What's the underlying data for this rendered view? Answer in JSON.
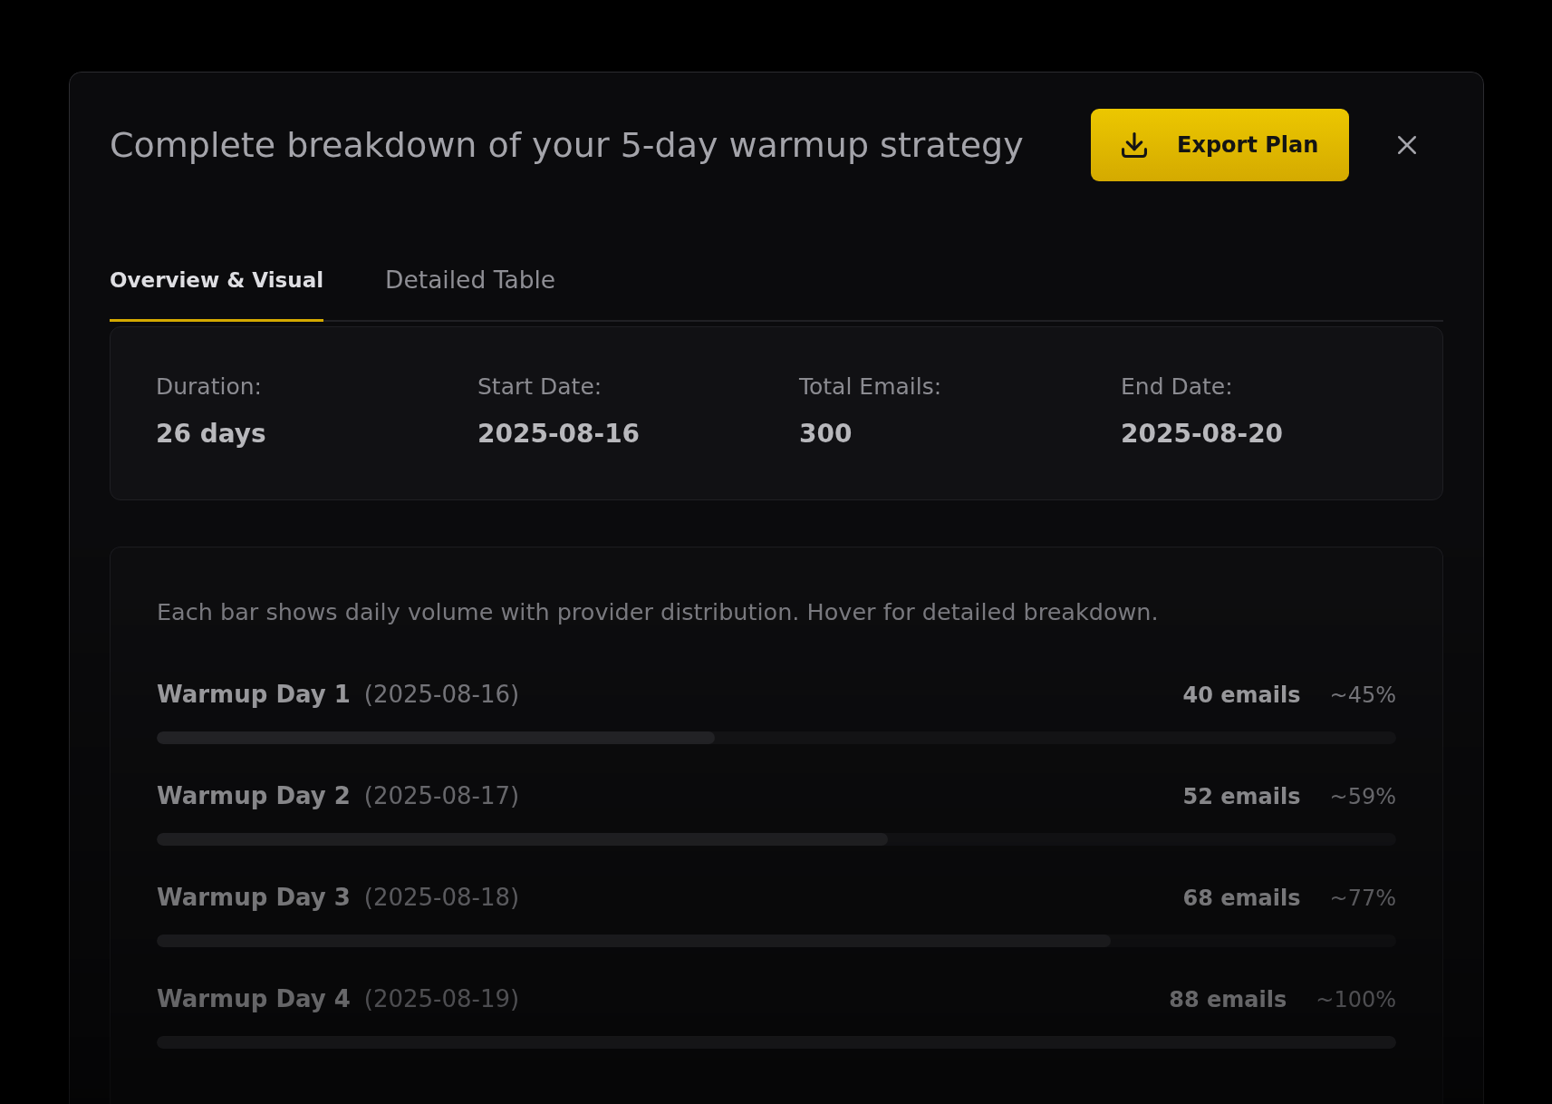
{
  "dialog": {
    "title": "Complete breakdown of your 5-day warmup strategy",
    "export_button": {
      "label": "Export Plan"
    },
    "tabs": [
      {
        "label": "Overview & Visual",
        "selected": true
      },
      {
        "label": "Detailed Table",
        "selected": false
      }
    ],
    "summary": [
      {
        "label": "Duration:",
        "value": "26 days"
      },
      {
        "label": "Start Date:",
        "value": "2025-08-16"
      },
      {
        "label": "Total Emails:",
        "value": "300"
      },
      {
        "label": "End Date:",
        "value": "2025-08-20"
      }
    ],
    "volume_chart": {
      "description": "Each bar shows daily volume with provider distribution. Hover for detailed breakdown.",
      "days": [
        {
          "label": "Warmup Day 1",
          "date": "(2025-08-16)",
          "emails": "40 emails",
          "share": "~45%",
          "level": 0.45
        },
        {
          "label": "Warmup Day 2",
          "date": "(2025-08-17)",
          "emails": "52 emails",
          "share": "~59%",
          "level": 0.59
        },
        {
          "label": "Warmup Day 3",
          "date": "(2025-08-18)",
          "emails": "68 emails",
          "share": "~77%",
          "level": 0.77
        },
        {
          "label": "Warmup Day 4",
          "date": "(2025-08-19)",
          "emails": "88 emails",
          "share": "~100%",
          "level": 1.0
        }
      ]
    }
  }
}
